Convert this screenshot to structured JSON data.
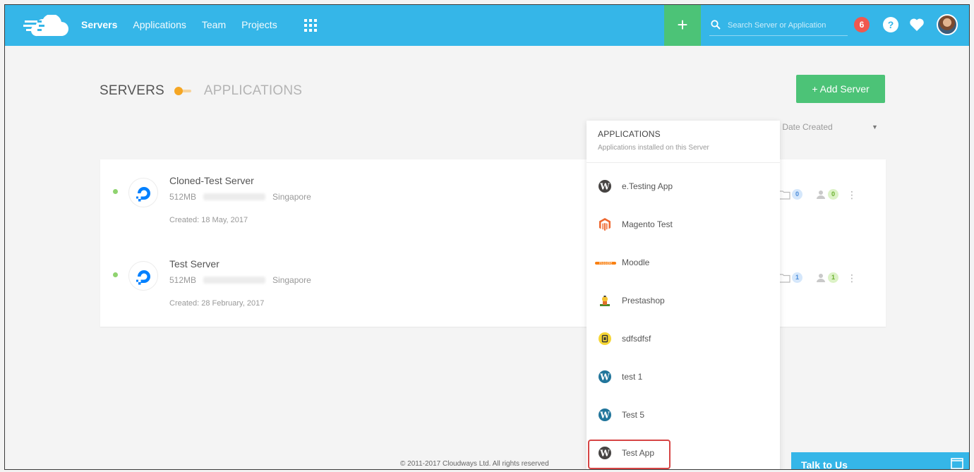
{
  "topbar": {
    "nav": [
      "Servers",
      "Applications",
      "Team",
      "Projects"
    ],
    "active": "Servers",
    "plus_label": "+",
    "search_placeholder": "Search Server or Application",
    "notification_count": "6",
    "help_label": "?"
  },
  "header": {
    "tab_servers": "SERVERS",
    "tab_applications": "APPLICATIONS",
    "add_server_label": "+ Add Server",
    "sort_label": "y  Date Created"
  },
  "servers": [
    {
      "name": "Cloned-Test Server",
      "size": "512MB",
      "location": "Singapore",
      "created": "Created: 18 May, 2017",
      "apps_count": "0",
      "team_count": "0"
    },
    {
      "name": "Test Server",
      "size": "512MB",
      "location": "Singapore",
      "created": "Created: 28 February, 2017",
      "apps_count": "1",
      "team_count": "1"
    }
  ],
  "apps_dropdown": {
    "title": "APPLICATIONS",
    "subtitle": "Applications installed on this Server",
    "items": [
      {
        "label": "e.Testing App",
        "icon": "wordpress-icon"
      },
      {
        "label": "Magento Test",
        "icon": "magento-icon"
      },
      {
        "label": "Moodle",
        "icon": "moodle-icon"
      },
      {
        "label": "Prestashop",
        "icon": "prestashop-icon"
      },
      {
        "label": "sdfsdfsf",
        "icon": "php-icon"
      },
      {
        "label": "test 1",
        "icon": "wordpress-icon"
      },
      {
        "label": "Test 5",
        "icon": "wordpress-icon"
      },
      {
        "label": "Test App",
        "icon": "wordpress-icon"
      }
    ],
    "selected": "Test App"
  },
  "footer": {
    "copyright": "© 2011-2017 Cloudways Ltd. All rights reserved",
    "talk_label": "Talk to Us"
  },
  "colors": {
    "topbar": "#35b6e8",
    "accent_green": "#4cc377",
    "toggle_orange": "#f5a623",
    "selection_red": "#d64545"
  }
}
